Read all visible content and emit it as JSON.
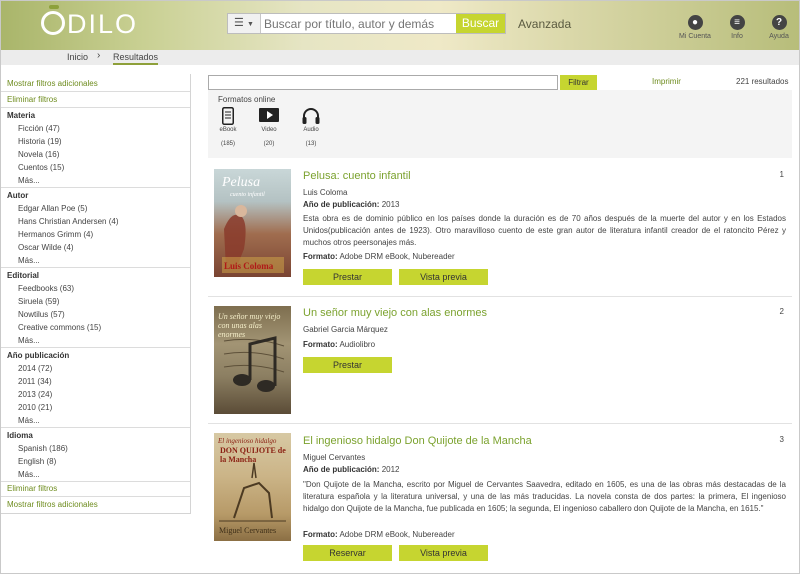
{
  "header": {
    "logo_text": "DILO",
    "search_placeholder": "Buscar por título, autor y demás",
    "search_button": "Buscar",
    "advanced": "Avanzada",
    "icons": [
      {
        "icon": "user-icon",
        "label": "Mi Cuenta"
      },
      {
        "icon": "menu-icon",
        "label": "Info"
      },
      {
        "icon": "help-icon",
        "label": "Ayuda"
      }
    ]
  },
  "breadcrumb": {
    "home": "Inicio",
    "current": "Resultados"
  },
  "sidebar": {
    "show_more_filters": "Mostrar filtros adicionales",
    "clear_filters": "Eliminar filtros",
    "groups": [
      {
        "title": "Materia",
        "items": [
          "Ficción (47)",
          "Historia (19)",
          "Novela (16)",
          "Cuentos (15)"
        ],
        "more": "Más..."
      },
      {
        "title": "Autor",
        "items": [
          "Edgar Allan Poe (5)",
          "Hans Christian Andersen (4)",
          "Hermanos Grimm (4)",
          "Oscar Wilde (4)"
        ],
        "more": "Más..."
      },
      {
        "title": "Editorial",
        "items": [
          "Feedbooks (63)",
          "Siruela (59)",
          "Nowtilus (57)",
          "Creative commons (15)"
        ],
        "more": "Más..."
      },
      {
        "title": "Año publicación",
        "items": [
          "2014 (72)",
          "2011 (34)",
          "2013 (24)",
          "2010 (21)"
        ],
        "more": "Más..."
      },
      {
        "title": "Idioma",
        "items": [
          "Spanish (186)",
          "English (8)"
        ],
        "more": "Más..."
      }
    ],
    "clear_filters_bottom": "Eliminar filtros",
    "show_more_filters_bottom": "Mostrar filtros adicionales"
  },
  "toolbar": {
    "filter_button": "Filtrar",
    "print": "Imprimir",
    "results_count": "221 resultados"
  },
  "formats": {
    "title": "Formatos online",
    "items": [
      {
        "label": "eBook",
        "count": "(185)",
        "icon": "ebook-icon"
      },
      {
        "label": "Video",
        "count": "(20)",
        "icon": "video-icon"
      },
      {
        "label": "Audio",
        "count": "(13)",
        "icon": "headphones-icon"
      }
    ]
  },
  "results": [
    {
      "number": "1",
      "title": "Pelusa: cuento infantil",
      "author": "Luis Coloma",
      "year_label": "Año de publicación:",
      "year": "2013",
      "description": "Esta obra es de dominio público en los países donde la duración es de 70 años después de la muerte del autor y en los Estados Unidos(publicación antes de 1923). Otro maravilloso cuento de este gran autor de literatura infantil creador de el ratoncito Pérez y muchos otros peersonajes más.",
      "format_label": "Formato:",
      "format": "Adobe DRM eBook, Nubereader",
      "primary_button": "Prestar",
      "secondary_button": "Vista previa",
      "cover_title": "Pelusa",
      "cover_subtitle": "cuento infantil",
      "cover_author": "Luis Coloma"
    },
    {
      "number": "2",
      "title": "Un señor muy viejo con alas enormes",
      "author": "Gabriel Garcia Márquez",
      "format_label": "Formato:",
      "format": "Audiolibro",
      "primary_button": "Prestar",
      "cover_title": "Un señor muy viejo con unas alas enormes"
    },
    {
      "number": "3",
      "title": "El ingenioso hidalgo Don Quijote de la Mancha",
      "author": "Miguel Cervantes",
      "year_label": "Año de publicación:",
      "year": "2012",
      "description": "\"Don Quijote de la Mancha, escrito por Miguel de Cervantes Saavedra, editado en 1605, es una de las obras más destacadas de la literatura española y la literatura universal, y una de las más traducidas. La novela consta de dos partes: la primera, El ingenioso hidalgo don Quijote de la Mancha, fue publicada en 1605; la segunda, El ingenioso caballero don Quijote de la Mancha, en 1615.\"",
      "format_label": "Formato:",
      "format": "Adobe DRM eBook, Nubereader",
      "primary_button": "Reservar",
      "secondary_button": "Vista previa",
      "cover_title": "El ingenioso hidalgo",
      "cover_subtitle": "DON QUIJOTE de la Mancha",
      "cover_author": "Miguel Cervantes"
    }
  ]
}
